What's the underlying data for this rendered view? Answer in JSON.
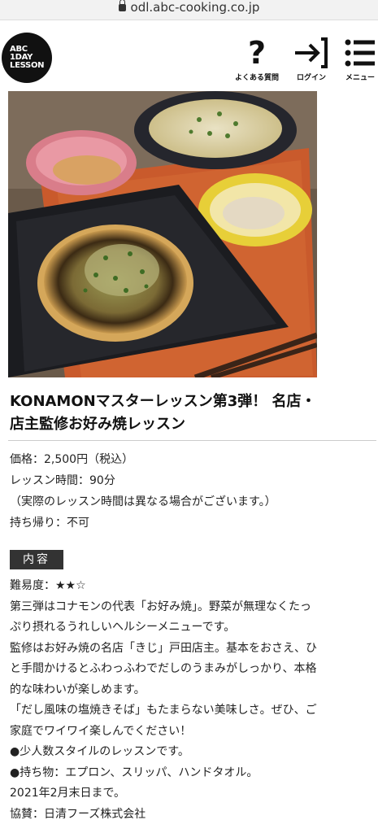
{
  "browser": {
    "url": "odl.abc-cooking.co.jp"
  },
  "header": {
    "logo_lines": [
      "ABC",
      "1DAY",
      "LESSON"
    ],
    "faq_label": "よくある質問",
    "login_label": "ログイン",
    "menu_label": "メニュー"
  },
  "lesson": {
    "title_line1": "KONAMONマスターレッスン第3弾！ 名店・",
    "title_line2": "店主監修お好み焼レッスン",
    "price": "価格：2,500円（税込）",
    "duration": "レッスン時間：90分",
    "duration_note": "（実際のレッスン時間は異なる場合がございます。）",
    "takeaway": "持ち帰り：不可"
  },
  "content": {
    "section_label": "内容",
    "difficulty": "難易度：★★☆",
    "lines": [
      "第三弾はコナモンの代表「お好み焼」。野菜が無理なくたっ",
      "ぷり摂れるうれしいヘルシーメニューです。",
      "監修はお好み焼の名店「きじ」戸田店主。基本をおさえ、ひ",
      "と手間かけるとふわっふわでだしのうまみがしっかり、本格",
      "的な味わいが楽しめます。",
      "「だし風味の塩焼きそば」もたまらない美味しさ。ぜひ、ご",
      "家庭でワイワイ楽しんでください！",
      "●少人数スタイルのレッスンです。",
      "●持ち物：エプロン、スリッパ、ハンドタオル。",
      "2021年2月末日まで。",
      "協賛：日清フーズ株式会社"
    ]
  }
}
